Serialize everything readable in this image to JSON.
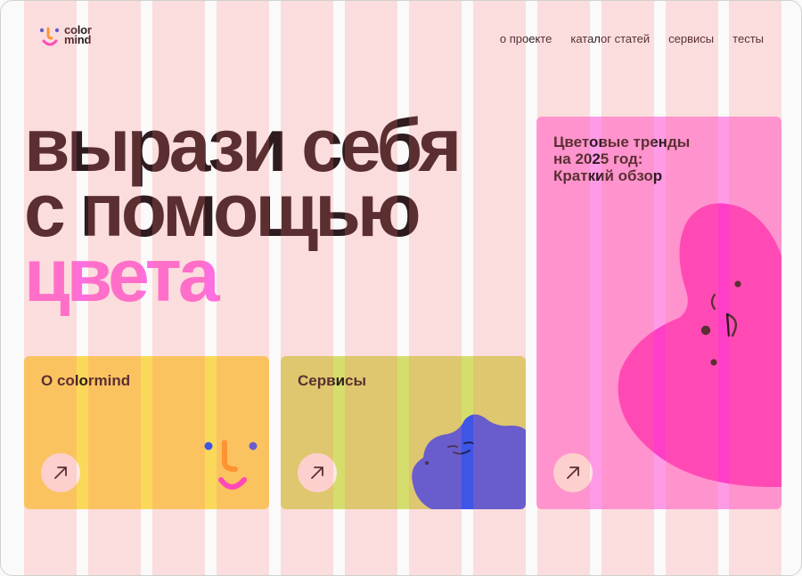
{
  "brand": {
    "line1": "color",
    "line2": "mind"
  },
  "nav": {
    "items": [
      "о проекте",
      "каталог статей",
      "сервисы",
      "тесты"
    ]
  },
  "hero": {
    "line1": "вырази себя",
    "line2": "с помощью",
    "line3": "цвета"
  },
  "cards": {
    "about": {
      "title": "О colormind"
    },
    "services": {
      "title": "Сервисы"
    },
    "trends": {
      "title_lines": [
        "Цветовые тренды",
        "на 2025 год:",
        "Краткий обзор"
      ]
    }
  },
  "icons": {
    "logo": "colormind-smile-logo-icon",
    "arrow": "arrow-up-right-icon",
    "mascot_yellow": "smile-face-icon",
    "mascot_blue": "blue-blob-face-icon",
    "mascot_pink": "pink-blob-face-icon"
  },
  "colors": {
    "text": "#2d1b1f",
    "accent_pink": "#ff6ee0",
    "card_yellow": "#fad95a",
    "card_green": "#d5de6c",
    "card_pink": "#ff9be6",
    "blob_blue": "#3f55e6",
    "blob_pink": "#ff3ec8",
    "arrow_bg": "#fde9e6",
    "grid_overlay": "#ffd6d6"
  }
}
